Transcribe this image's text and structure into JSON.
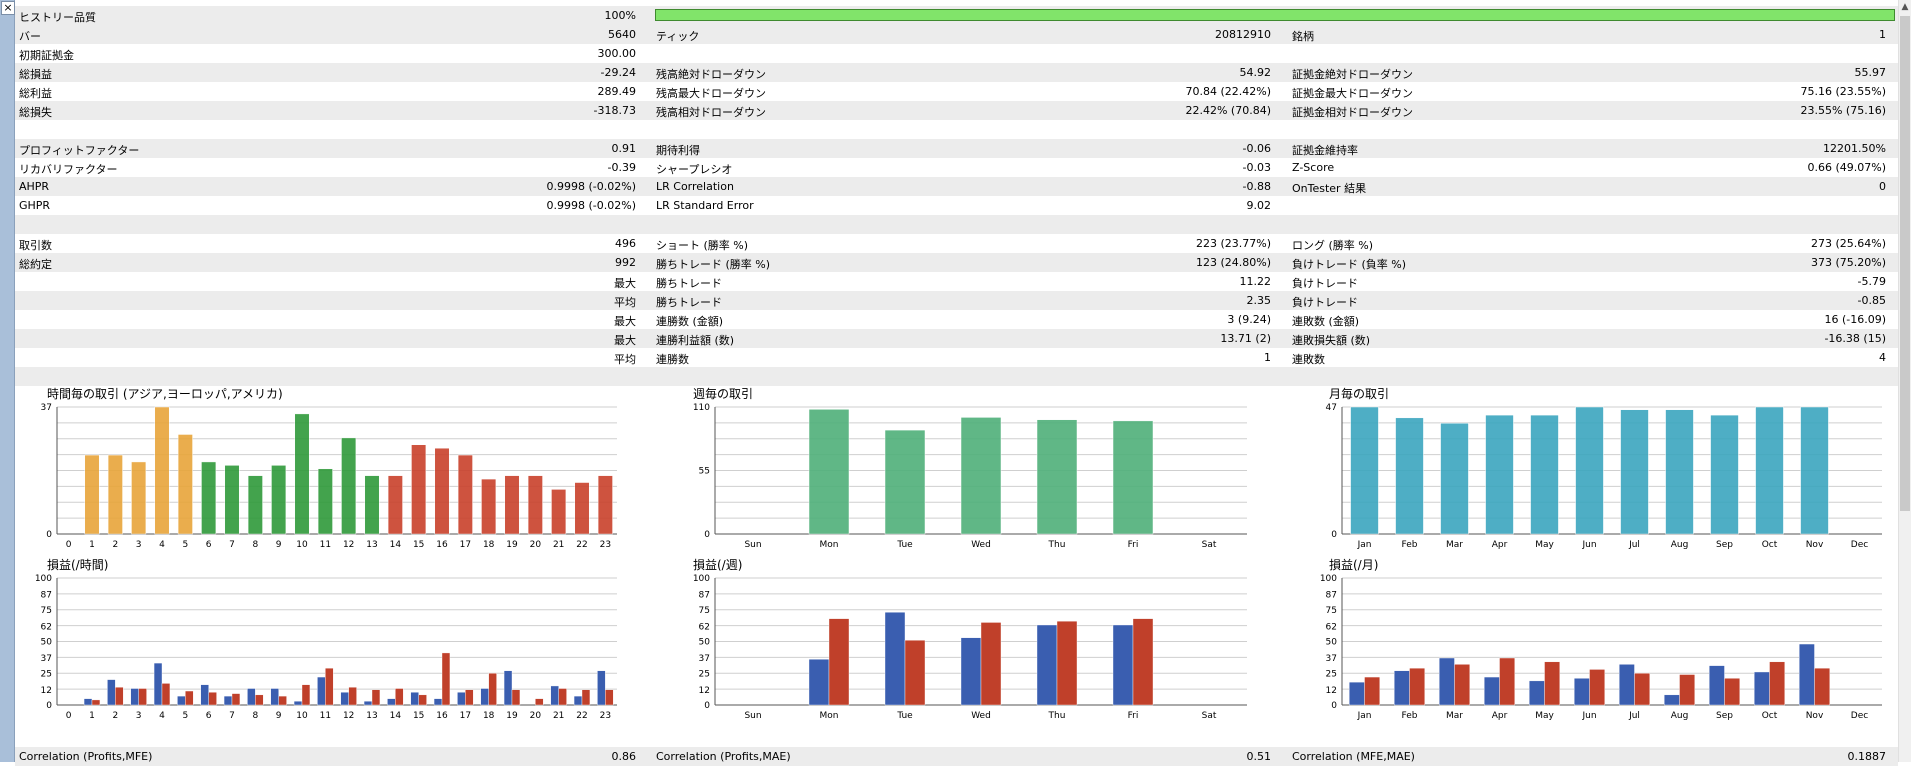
{
  "rows": [
    {
      "alt": true,
      "cells": [
        "ヒストリー品質",
        "100%",
        "",
        "",
        "",
        ""
      ],
      "bar": true
    },
    {
      "alt": true,
      "cells": [
        "バー",
        "5640",
        "ティック",
        "20812910",
        "銘柄",
        "1"
      ]
    },
    {
      "alt": false,
      "cells": [
        "初期証拠金",
        "300.00",
        "",
        "",
        "",
        ""
      ]
    },
    {
      "alt": true,
      "cells": [
        "総損益",
        "-29.24",
        "残高絶対ドローダウン",
        "54.92",
        "証拠金絶対ドローダウン",
        "55.97"
      ]
    },
    {
      "alt": false,
      "cells": [
        "総利益",
        "289.49",
        "残高最大ドローダウン",
        "70.84 (22.42%)",
        "証拠金最大ドローダウン",
        "75.16 (23.55%)"
      ]
    },
    {
      "alt": true,
      "cells": [
        "総損失",
        "-318.73",
        "残高相対ドローダウン",
        "22.42% (70.84)",
        "証拠金相対ドローダウン",
        "23.55% (75.16)"
      ]
    },
    {
      "blank": true
    },
    {
      "alt": true,
      "cells": [
        "プロフィットファクター",
        "0.91",
        "期待利得",
        "-0.06",
        "証拠金維持率",
        "12201.50%"
      ]
    },
    {
      "alt": false,
      "cells": [
        "リカバリファクター",
        "-0.39",
        "シャープレシオ",
        "-0.03",
        "Z-Score",
        "0.66 (49.07%)"
      ]
    },
    {
      "alt": true,
      "cells": [
        "AHPR",
        "0.9998 (-0.02%)",
        "LR Correlation",
        "-0.88",
        "OnTester 結果",
        "0"
      ]
    },
    {
      "alt": false,
      "cells": [
        "GHPR",
        "0.9998 (-0.02%)",
        "LR Standard Error",
        "9.02",
        "",
        ""
      ]
    },
    {
      "blank": true,
      "alt": true
    },
    {
      "alt": false,
      "cells": [
        "取引数",
        "496",
        "ショート (勝率 %)",
        "223 (23.77%)",
        "ロング (勝率 %)",
        "273 (25.64%)"
      ]
    },
    {
      "alt": true,
      "cells": [
        "総約定",
        "992",
        "勝ちトレード (勝率 %)",
        "123 (24.80%)",
        "負けトレード (負率 %)",
        "373 (75.20%)"
      ]
    },
    {
      "alt": false,
      "cells": [
        "",
        "最大",
        "勝ちトレード",
        "11.22",
        "負けトレード",
        "-5.79"
      ]
    },
    {
      "alt": true,
      "cells": [
        "",
        "平均",
        "勝ちトレード",
        "2.35",
        "負けトレード",
        "-0.85"
      ]
    },
    {
      "alt": false,
      "cells": [
        "",
        "最大",
        "連勝数 (金額)",
        "3 (9.24)",
        "連敗数 (金額)",
        "16 (-16.09)"
      ]
    },
    {
      "alt": true,
      "cells": [
        "",
        "最大",
        "連勝利益額 (数)",
        "13.71 (2)",
        "連敗損失額 (数)",
        "-16.38 (15)"
      ]
    },
    {
      "alt": false,
      "cells": [
        "",
        "平均",
        "連勝数",
        "1",
        "連敗数",
        "4"
      ]
    },
    {
      "blank": true,
      "alt": true
    }
  ],
  "correlation": [
    "Correlation (Profits,MFE)",
    "0.86",
    "Correlation (Profits,MAE)",
    "0.51",
    "Correlation (MFE,MAE)",
    "0.1887"
  ],
  "chart_data": [
    {
      "type": "bar",
      "title": "時間毎の取引 (アジア,ヨーロッパ,アメリカ)",
      "categories": [
        "0",
        "1",
        "2",
        "3",
        "4",
        "5",
        "6",
        "7",
        "8",
        "9",
        "10",
        "11",
        "12",
        "13",
        "14",
        "15",
        "16",
        "17",
        "18",
        "19",
        "20",
        "21",
        "22",
        "23"
      ],
      "values": [
        0,
        23,
        23,
        21,
        37,
        29,
        21,
        20,
        17,
        20,
        35,
        19,
        28,
        17,
        17,
        26,
        25,
        23,
        16,
        17,
        17,
        13,
        15,
        17
      ],
      "yticks": [
        "37",
        "0"
      ],
      "ylim": [
        0,
        37
      ],
      "colors": {
        "asia": "#e8a53a",
        "europe": "#2f9a3a",
        "america": "#c9412b"
      }
    },
    {
      "type": "bar",
      "title": "週毎の取引",
      "categories": [
        "Sun",
        "Mon",
        "Tue",
        "Wed",
        "Thu",
        "Fri",
        "Sat"
      ],
      "values": [
        0,
        108,
        90,
        101,
        99,
        98,
        0
      ],
      "yticks": [
        "110",
        "55",
        "0"
      ],
      "ylim": [
        0,
        110
      ],
      "colors": {
        "bar": "#4fb07a"
      }
    },
    {
      "type": "bar",
      "title": "月毎の取引",
      "categories": [
        "Jan",
        "Feb",
        "Mar",
        "Apr",
        "May",
        "Jun",
        "Jul",
        "Aug",
        "Sep",
        "Oct",
        "Nov",
        "Dec"
      ],
      "values": [
        47,
        43,
        41,
        44,
        44,
        47,
        46,
        46,
        44,
        47,
        47,
        0
      ],
      "yticks": [
        "47",
        "0"
      ],
      "ylim": [
        0,
        47
      ],
      "colors": {
        "bar": "#3ba6bf"
      }
    },
    {
      "type": "bar",
      "title": "損益(/時間)",
      "categories": [
        "0",
        "1",
        "2",
        "3",
        "4",
        "5",
        "6",
        "7",
        "8",
        "9",
        "10",
        "11",
        "12",
        "13",
        "14",
        "15",
        "16",
        "17",
        "18",
        "19",
        "20",
        "21",
        "22",
        "23"
      ],
      "series": [
        {
          "values": [
            0,
            5,
            20,
            13,
            33,
            7,
            16,
            7,
            13,
            13,
            3,
            22,
            10,
            3,
            5,
            10,
            5,
            10,
            13,
            27,
            0,
            15,
            7,
            27
          ]
        },
        {
          "values": [
            0,
            4,
            14,
            13,
            17,
            11,
            10,
            9,
            8,
            7,
            16,
            29,
            14,
            12,
            13,
            8,
            41,
            12,
            25,
            12,
            5,
            13,
            12,
            12
          ]
        }
      ],
      "yticks": [
        "100",
        "87",
        "75",
        "62",
        "50",
        "37",
        "25",
        "12",
        "0"
      ],
      "ylim": [
        0,
        100
      ],
      "colors": {
        "profit": "#3a5eb0",
        "loss": "#c0402a"
      }
    },
    {
      "type": "bar",
      "title": "損益(/週)",
      "categories": [
        "Sun",
        "Mon",
        "Tue",
        "Wed",
        "Thu",
        "Fri",
        "Sat"
      ],
      "series": [
        {
          "values": [
            0,
            36,
            73,
            53,
            63,
            63,
            0
          ]
        },
        {
          "values": [
            0,
            68,
            51,
            65,
            66,
            68,
            0
          ]
        }
      ],
      "yticks": [
        "100",
        "87",
        "75",
        "62",
        "50",
        "37",
        "25",
        "12",
        "0"
      ],
      "ylim": [
        0,
        100
      ],
      "colors": {
        "profit": "#3a5eb0",
        "loss": "#c0402a"
      }
    },
    {
      "type": "bar",
      "title": "損益(/月)",
      "categories": [
        "Jan",
        "Feb",
        "Mar",
        "Apr",
        "May",
        "Jun",
        "Jul",
        "Aug",
        "Sep",
        "Oct",
        "Nov",
        "Dec"
      ],
      "series": [
        {
          "values": [
            18,
            27,
            37,
            22,
            19,
            21,
            32,
            8,
            31,
            26,
            48,
            0
          ]
        },
        {
          "values": [
            22,
            29,
            32,
            37,
            34,
            28,
            25,
            24,
            21,
            34,
            29,
            0
          ]
        }
      ],
      "yticks": [
        "100",
        "87",
        "75",
        "62",
        "50",
        "37",
        "25",
        "12",
        "0"
      ],
      "ylim": [
        0,
        100
      ],
      "colors": {
        "profit": "#3a5eb0",
        "loss": "#c0402a"
      }
    }
  ]
}
